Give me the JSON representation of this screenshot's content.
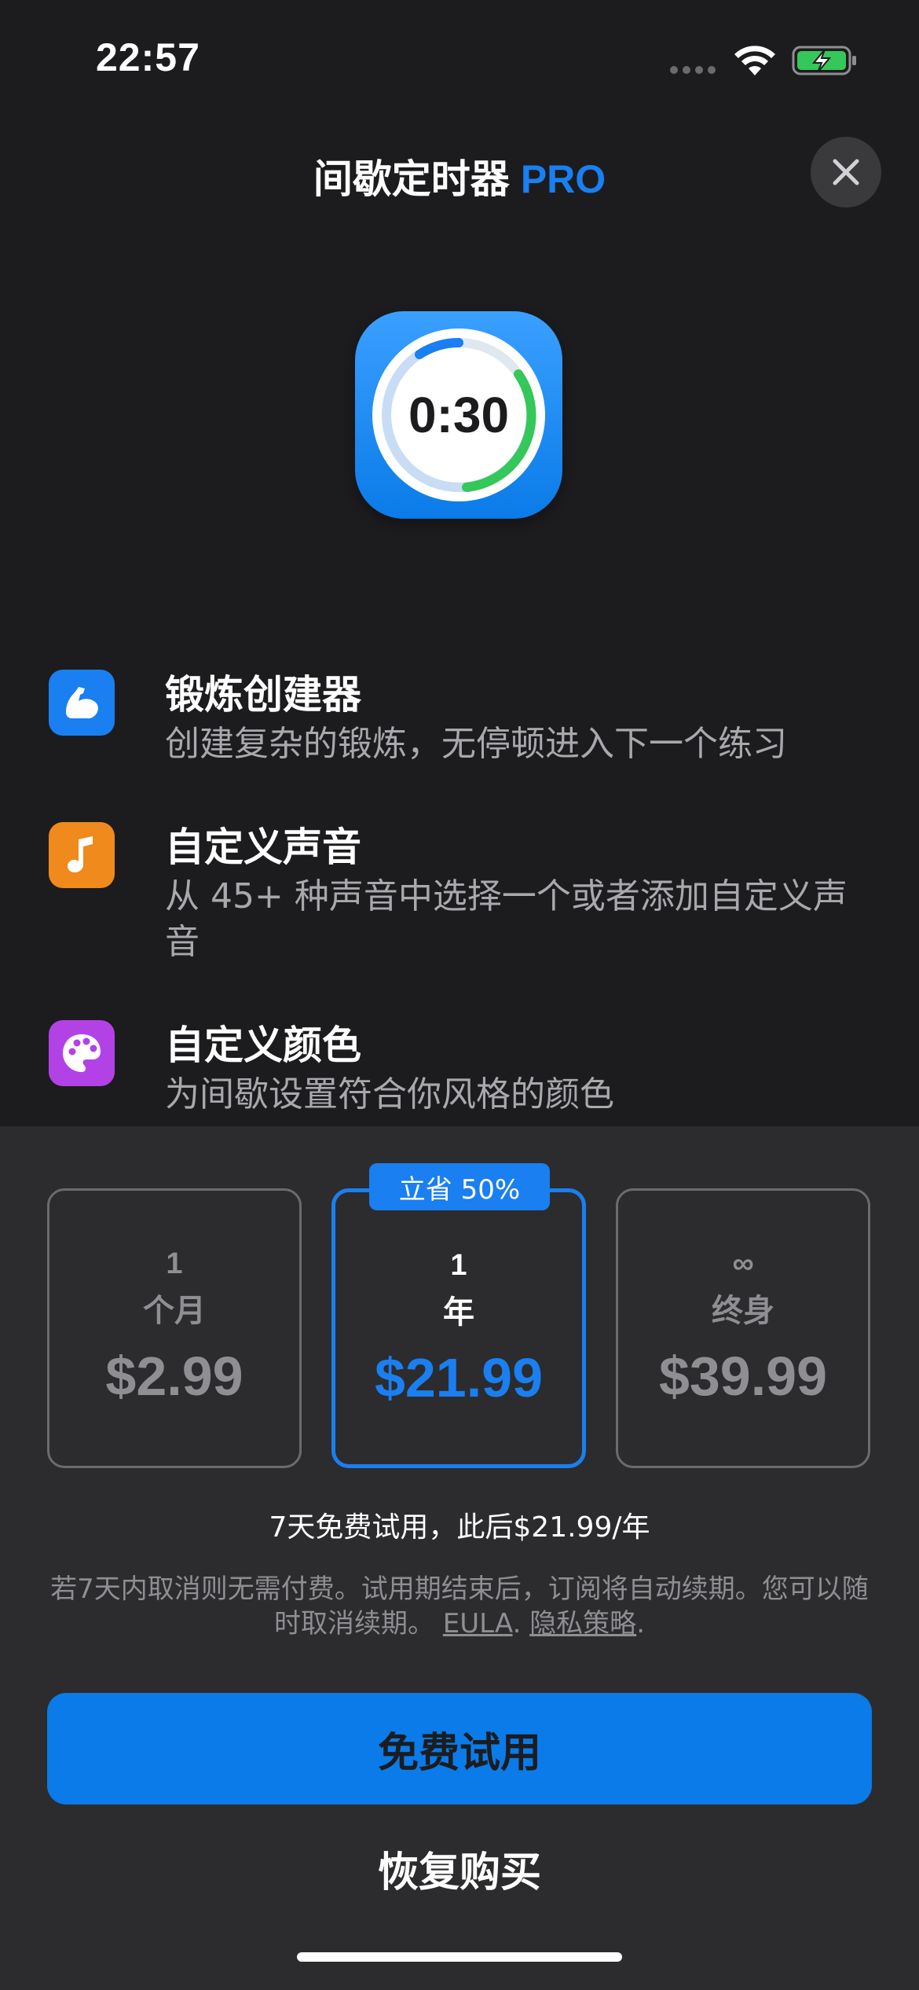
{
  "status_bar": {
    "time": "22:57"
  },
  "header": {
    "title": "间歇定时器",
    "badge": "PRO"
  },
  "app_icon": {
    "time": "0:30"
  },
  "features": [
    {
      "icon": "muscle-icon",
      "color": "#1a7ff0",
      "title": "锻炼创建器",
      "description": "创建复杂的锻炼，无停顿进入下一个练习"
    },
    {
      "icon": "music-note-icon",
      "color": "#f08a1c",
      "title": "自定义声音",
      "description": "从 45+ 种声音中选择一个或者添加自定义声音"
    },
    {
      "icon": "palette-icon",
      "color": "#b342e6",
      "title": "自定义颜色",
      "description": "为间歇设置符合你风格的颜色"
    }
  ],
  "plans": [
    {
      "count": "1",
      "period": "个月",
      "price": "$2.99",
      "selected": false
    },
    {
      "count": "1",
      "period": "年",
      "price": "$21.99",
      "selected": true,
      "badge": "立省 50%"
    },
    {
      "count": "∞",
      "period": "终身",
      "price": "$39.99",
      "selected": false
    }
  ],
  "trial_text": "7天免费试用，此后$21.99/年",
  "terms": {
    "text": "若7天内取消则无需付费。试用期结束后，订阅将自动续期。您可以随时取消续期。",
    "eula": "EULA",
    "privacy": "隐私策略",
    "sep1": ".",
    "sep2": "."
  },
  "cta_label": "免费试用",
  "restore_label": "恢复购买",
  "colors": {
    "accent": "#1a7ff0",
    "background": "#1c1c1e",
    "sheet": "#2c2c2e"
  }
}
